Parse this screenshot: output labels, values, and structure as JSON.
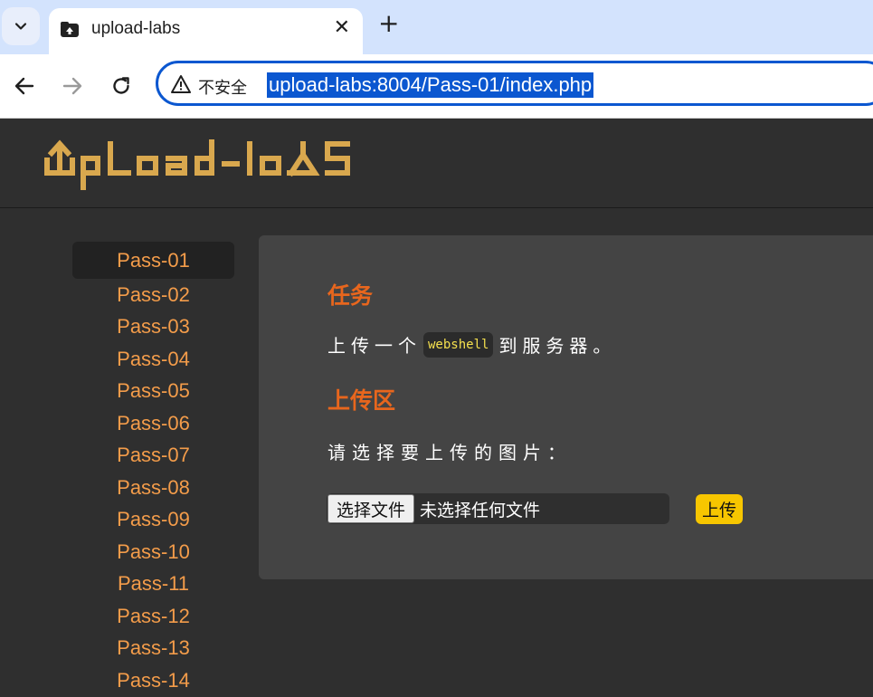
{
  "browser": {
    "tab": {
      "title": "upload-labs",
      "favicon": "upload-labs-icon"
    },
    "address_bar": {
      "security_label": "不安全",
      "url": "upload-labs:8004/Pass-01/index.php"
    }
  },
  "sidebar": {
    "items": [
      {
        "label": "Pass-01"
      },
      {
        "label": "Pass-02"
      },
      {
        "label": "Pass-03"
      },
      {
        "label": "Pass-04"
      },
      {
        "label": "Pass-05"
      },
      {
        "label": "Pass-06"
      },
      {
        "label": "Pass-07"
      },
      {
        "label": "Pass-08"
      },
      {
        "label": "Pass-09"
      },
      {
        "label": "Pass-10"
      },
      {
        "label": "Pass-11"
      },
      {
        "label": "Pass-12"
      },
      {
        "label": "Pass-13"
      },
      {
        "label": "Pass-14"
      }
    ],
    "active_index": 0
  },
  "main": {
    "task_heading": "任务",
    "task_prefix": "上传一个",
    "task_code": "webshell",
    "task_suffix": "到服务器。",
    "upload_heading": "上传区",
    "upload_prompt": "请选择要上传的图片：",
    "file_button_label": "选择文件",
    "file_status": "未选择任何文件",
    "submit_label": "上传"
  },
  "colors": {
    "page_bg": "#2f2f2f",
    "panel_bg": "#444444",
    "sidebar_link": "#f39c4a",
    "heading_orange": "#e8661d",
    "logo_gold": "#d9a84e",
    "submit_yellow": "#f7c600",
    "omnibox_blue": "#0b57d0"
  }
}
